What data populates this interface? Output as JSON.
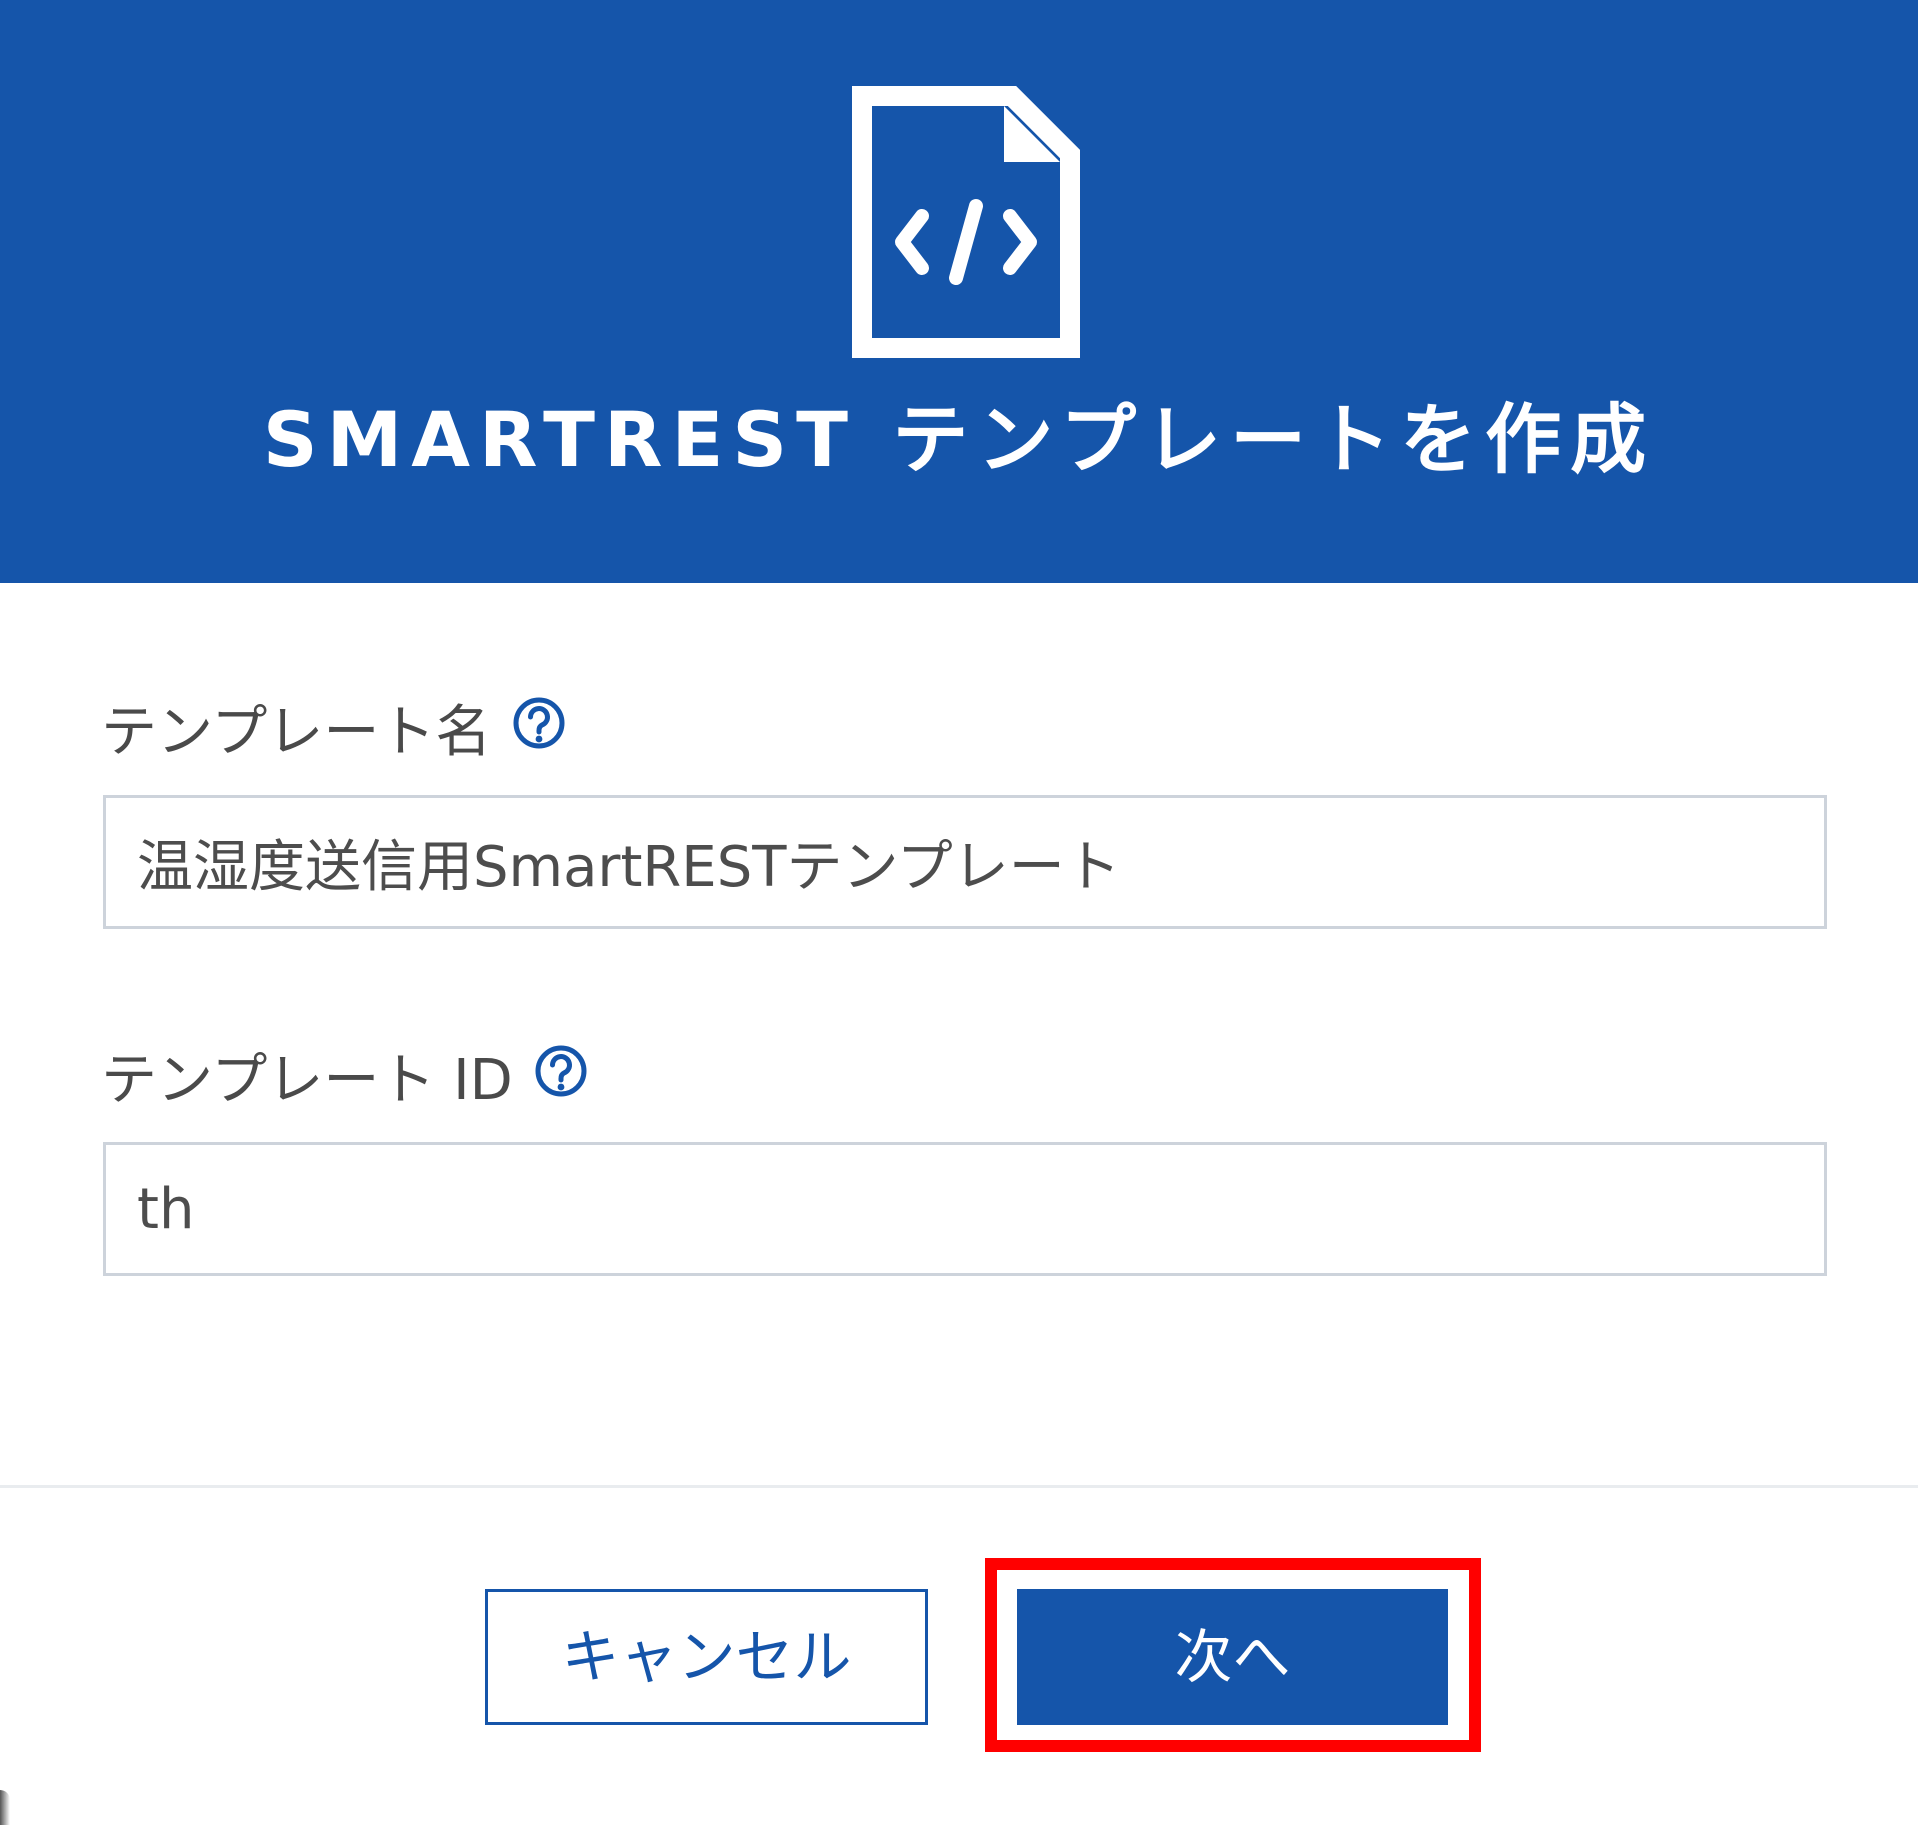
{
  "dialog": {
    "title": "SMARTREST テンプレートを作成",
    "header_icon": "code-file-icon"
  },
  "form": {
    "template_name": {
      "label": "テンプレート名",
      "help_icon": "question-circle-icon",
      "value": "温湿度送信用SmartRESTテンプレート"
    },
    "template_id": {
      "label": "テンプレート ID",
      "help_icon": "question-circle-icon",
      "value": "th"
    }
  },
  "footer": {
    "cancel_label": "キャンセル",
    "next_label": "次へ"
  },
  "colors": {
    "primary": "#1555aa",
    "highlight": "#ff0000"
  }
}
